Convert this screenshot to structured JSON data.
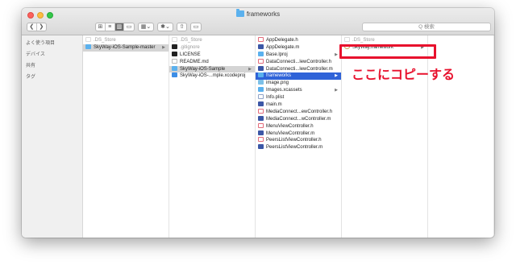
{
  "window": {
    "title": "frameworks"
  },
  "toolbar": {
    "back_label": "❮",
    "forward_label": "❯",
    "view_icons_label": "⊞",
    "view_list_label": "≡",
    "view_columns_label": "▥",
    "view_gallery_label": "▭",
    "group_label": "▦⌄",
    "action_label": "✱⌄",
    "share_label": "⇧",
    "tag_label": "▭"
  },
  "search": {
    "placeholder": "Q 検索"
  },
  "sidebar": {
    "items": [
      {
        "label": "よく使う項目"
      },
      {
        "label": "デバイス"
      },
      {
        "label": "共有"
      },
      {
        "label": "タグ"
      }
    ]
  },
  "columns": [
    {
      "items": [
        {
          "label": ".DS_Store",
          "icon": "file-dim",
          "dim": true
        },
        {
          "label": "SkyWay-iOS-Sample-master",
          "icon": "folder",
          "selected": "gray",
          "has_children": true
        }
      ]
    },
    {
      "items": [
        {
          "label": ".DS_Store",
          "icon": "file-dim",
          "dim": true
        },
        {
          "label": ".gitignore",
          "icon": "black",
          "dim": true
        },
        {
          "label": "LICENSE",
          "icon": "black"
        },
        {
          "label": "README.md",
          "icon": "file"
        },
        {
          "label": "SkyWay-iOS-Sample",
          "icon": "folder",
          "selected": "gray",
          "has_children": true
        },
        {
          "label": "SkyWay-iOS-...mple.xcodeproj",
          "icon": "xproj"
        }
      ]
    },
    {
      "items": [
        {
          "label": "AppDelegate.h",
          "icon": "h"
        },
        {
          "label": "AppDelegate.m",
          "icon": "m"
        },
        {
          "label": "Base.lproj",
          "icon": "folder",
          "has_children": true
        },
        {
          "label": "DataConnecti...lewController.h",
          "icon": "h"
        },
        {
          "label": "DataConnecti...lewController.m",
          "icon": "m"
        },
        {
          "label": "frameworks",
          "icon": "folder",
          "selected": "blue",
          "has_children": true
        },
        {
          "label": "image.png",
          "icon": "img"
        },
        {
          "label": "Images.xcassets",
          "icon": "folder",
          "has_children": true
        },
        {
          "label": "Info.plist",
          "icon": "plist"
        },
        {
          "label": "main.m",
          "icon": "m"
        },
        {
          "label": "MediaConnect...ewController.h",
          "icon": "h"
        },
        {
          "label": "MediaConnect...wController.m",
          "icon": "m"
        },
        {
          "label": "MenuViewController.h",
          "icon": "h"
        },
        {
          "label": "MenuViewController.m",
          "icon": "m"
        },
        {
          "label": "PeersListViewController.h",
          "icon": "h"
        },
        {
          "label": "PeersListViewController.m",
          "icon": "m"
        }
      ]
    },
    {
      "items": [
        {
          "label": ".DS_Store",
          "icon": "file-dim",
          "dim": true
        },
        {
          "label": "SkyWay.framework",
          "icon": "fw",
          "has_children": true
        }
      ]
    }
  ],
  "annotation": {
    "text": "ここにコピーする",
    "color": "#e8112d"
  },
  "colors": {
    "selection_blue": "#2f63d8",
    "selection_gray": "#d4d4d4",
    "folder": "#5bb1ee"
  }
}
